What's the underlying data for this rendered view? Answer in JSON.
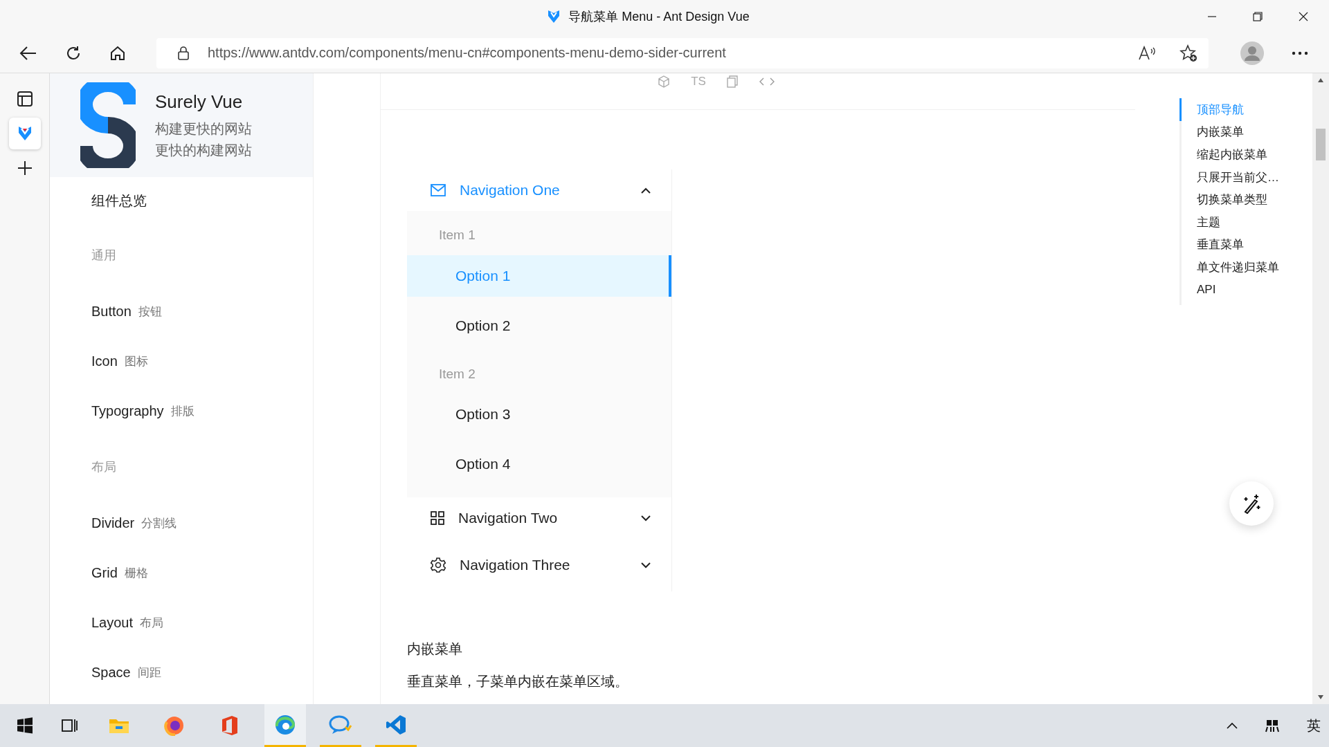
{
  "window": {
    "title": "导航菜单 Menu - Ant Design Vue"
  },
  "address_bar": {
    "url": "https://www.antdv.com/components/menu-cn#components-menu-demo-sider-current"
  },
  "vertical_tabs": [
    {
      "kind": "site",
      "selected": true
    }
  ],
  "sidebar": {
    "logo_title": "Surely Vue",
    "taglines": [
      "构建更快的网站",
      "更快的构建网站"
    ],
    "items": [
      {
        "kind": "item",
        "label": "组件总览"
      },
      {
        "kind": "group",
        "label": "通用"
      },
      {
        "kind": "item",
        "label": "Button",
        "sub": "按钮"
      },
      {
        "kind": "item",
        "label": "Icon",
        "sub": "图标"
      },
      {
        "kind": "item",
        "label": "Typography",
        "sub": "排版"
      },
      {
        "kind": "group",
        "label": "布局"
      },
      {
        "kind": "item",
        "label": "Divider",
        "sub": "分割线"
      },
      {
        "kind": "item",
        "label": "Grid",
        "sub": "栅格"
      },
      {
        "kind": "item",
        "label": "Layout",
        "sub": "布局"
      },
      {
        "kind": "item",
        "label": "Space",
        "sub": "间距"
      }
    ]
  },
  "demo_toolbar": {
    "ts_label": "TS"
  },
  "menu": [
    {
      "label": "Navigation One",
      "kind": "mail",
      "expanded": true,
      "groups": [
        {
          "title": "Item 1",
          "options": [
            {
              "label": "Option 1",
              "selected": true
            },
            {
              "label": "Option 2",
              "selected": false
            }
          ]
        },
        {
          "title": "Item 2",
          "options": [
            {
              "label": "Option 3",
              "selected": false
            },
            {
              "label": "Option 4",
              "selected": false
            }
          ]
        }
      ]
    },
    {
      "label": "Navigation Two",
      "kind": "grid",
      "expanded": false
    },
    {
      "label": "Navigation Three",
      "kind": "setting",
      "expanded": false
    }
  ],
  "next_demo": {
    "title": "内嵌菜单",
    "description": "垂直菜单，子菜单内嵌在菜单区域。"
  },
  "toc": [
    {
      "label": "顶部导航",
      "selected": true
    },
    {
      "label": "内嵌菜单",
      "selected": false
    },
    {
      "label": "缩起内嵌菜单",
      "selected": false
    },
    {
      "label": "只展开当前父…",
      "selected": false
    },
    {
      "label": "切换菜单类型",
      "selected": false
    },
    {
      "label": "主题",
      "selected": false
    },
    {
      "label": "垂直菜单",
      "selected": false
    },
    {
      "label": "单文件递归菜单",
      "selected": false
    },
    {
      "label": "API",
      "selected": false
    }
  ],
  "taskbar": {
    "apps": [
      {
        "kind": "explorer",
        "running": false,
        "active": false
      },
      {
        "kind": "firefox",
        "running": false,
        "active": false
      },
      {
        "kind": "office",
        "running": false,
        "active": false
      },
      {
        "kind": "edge",
        "running": true,
        "active": true
      },
      {
        "kind": "chat",
        "running": true,
        "active": false
      },
      {
        "kind": "vscode",
        "running": true,
        "active": false
      }
    ],
    "ime": "英"
  }
}
